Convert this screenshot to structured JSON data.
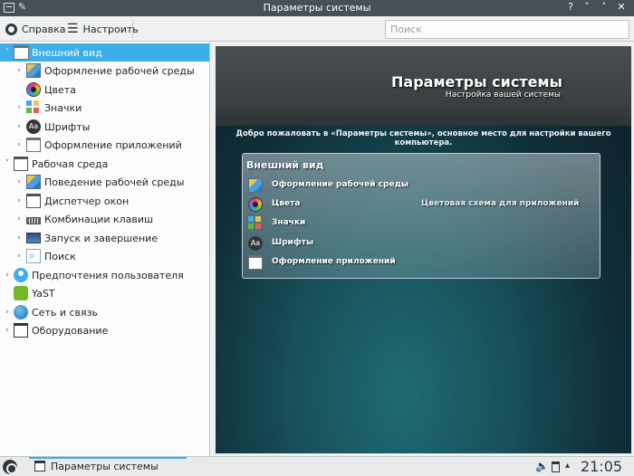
{
  "window": {
    "title": "Параметры системы",
    "buttons": [
      "?",
      "˅",
      "˄",
      "✕"
    ]
  },
  "toolbar": {
    "help_label": "Справка",
    "configure_label": "Настроить",
    "search_placeholder": "Поиск"
  },
  "tree": {
    "items": [
      {
        "label": "Внешний вид",
        "level": 0,
        "expander": "˅",
        "icon": "window-icon",
        "selected": true
      },
      {
        "label": "Оформление рабочей среды",
        "level": 1,
        "expander": "›",
        "icon": "workspace-theme-icon"
      },
      {
        "label": "Цвета",
        "level": 1,
        "expander": "",
        "icon": "colors-icon"
      },
      {
        "label": "Значки",
        "level": 1,
        "expander": "›",
        "icon": "icons-icon"
      },
      {
        "label": "Шрифты",
        "level": 1,
        "expander": "›",
        "icon": "fonts-icon"
      },
      {
        "label": "Оформление приложений",
        "level": 1,
        "expander": "›",
        "icon": "app-style-icon"
      },
      {
        "label": "Рабочая среда",
        "level": 0,
        "expander": "˅",
        "icon": "workspace-icon"
      },
      {
        "label": "Поведение рабочей среды",
        "level": 1,
        "expander": "›",
        "icon": "workspace-behavior-icon"
      },
      {
        "label": "Диспетчер окон",
        "level": 1,
        "expander": "›",
        "icon": "window-manager-icon"
      },
      {
        "label": "Комбинации клавиш",
        "level": 1,
        "expander": "›",
        "icon": "keyboard-icon"
      },
      {
        "label": "Запуск и завершение",
        "level": 1,
        "expander": "›",
        "icon": "startup-icon"
      },
      {
        "label": "Поиск",
        "level": 1,
        "expander": "›",
        "icon": "search-icon"
      },
      {
        "label": "Предпочтения пользователя",
        "level": 0,
        "expander": "›",
        "icon": "user-icon"
      },
      {
        "label": "YaST",
        "level": 0,
        "expander": "",
        "icon": "yast-icon"
      },
      {
        "label": "Сеть и связь",
        "level": 0,
        "expander": "›",
        "icon": "network-icon"
      },
      {
        "label": "Оборудование",
        "level": 0,
        "expander": "›",
        "icon": "hardware-icon"
      }
    ]
  },
  "main": {
    "hero_title": "Параметры системы",
    "hero_subtitle": "Настройка вашей системы",
    "welcome": "Добро пожаловать в «Параметры системы», основное место для настройки вашего компьютера.",
    "panel": {
      "title": "Внешний вид",
      "items": [
        {
          "label": "Оформление рабочей среды",
          "description": "",
          "icon": "workspace-theme-icon"
        },
        {
          "label": "Цвета",
          "description": "Цветовая схема для приложений",
          "icon": "colors-icon"
        },
        {
          "label": "Значки",
          "description": "",
          "icon": "icons-icon"
        },
        {
          "label": "Шрифты",
          "description": "",
          "icon": "fonts-icon"
        },
        {
          "label": "Оформление приложений",
          "description": "",
          "icon": "app-style-icon"
        }
      ]
    }
  },
  "taskbar": {
    "task_label": "Параметры системы",
    "clock": "21:05"
  },
  "colors": {
    "accent": "#3daee9",
    "titlebar": "#475057"
  }
}
